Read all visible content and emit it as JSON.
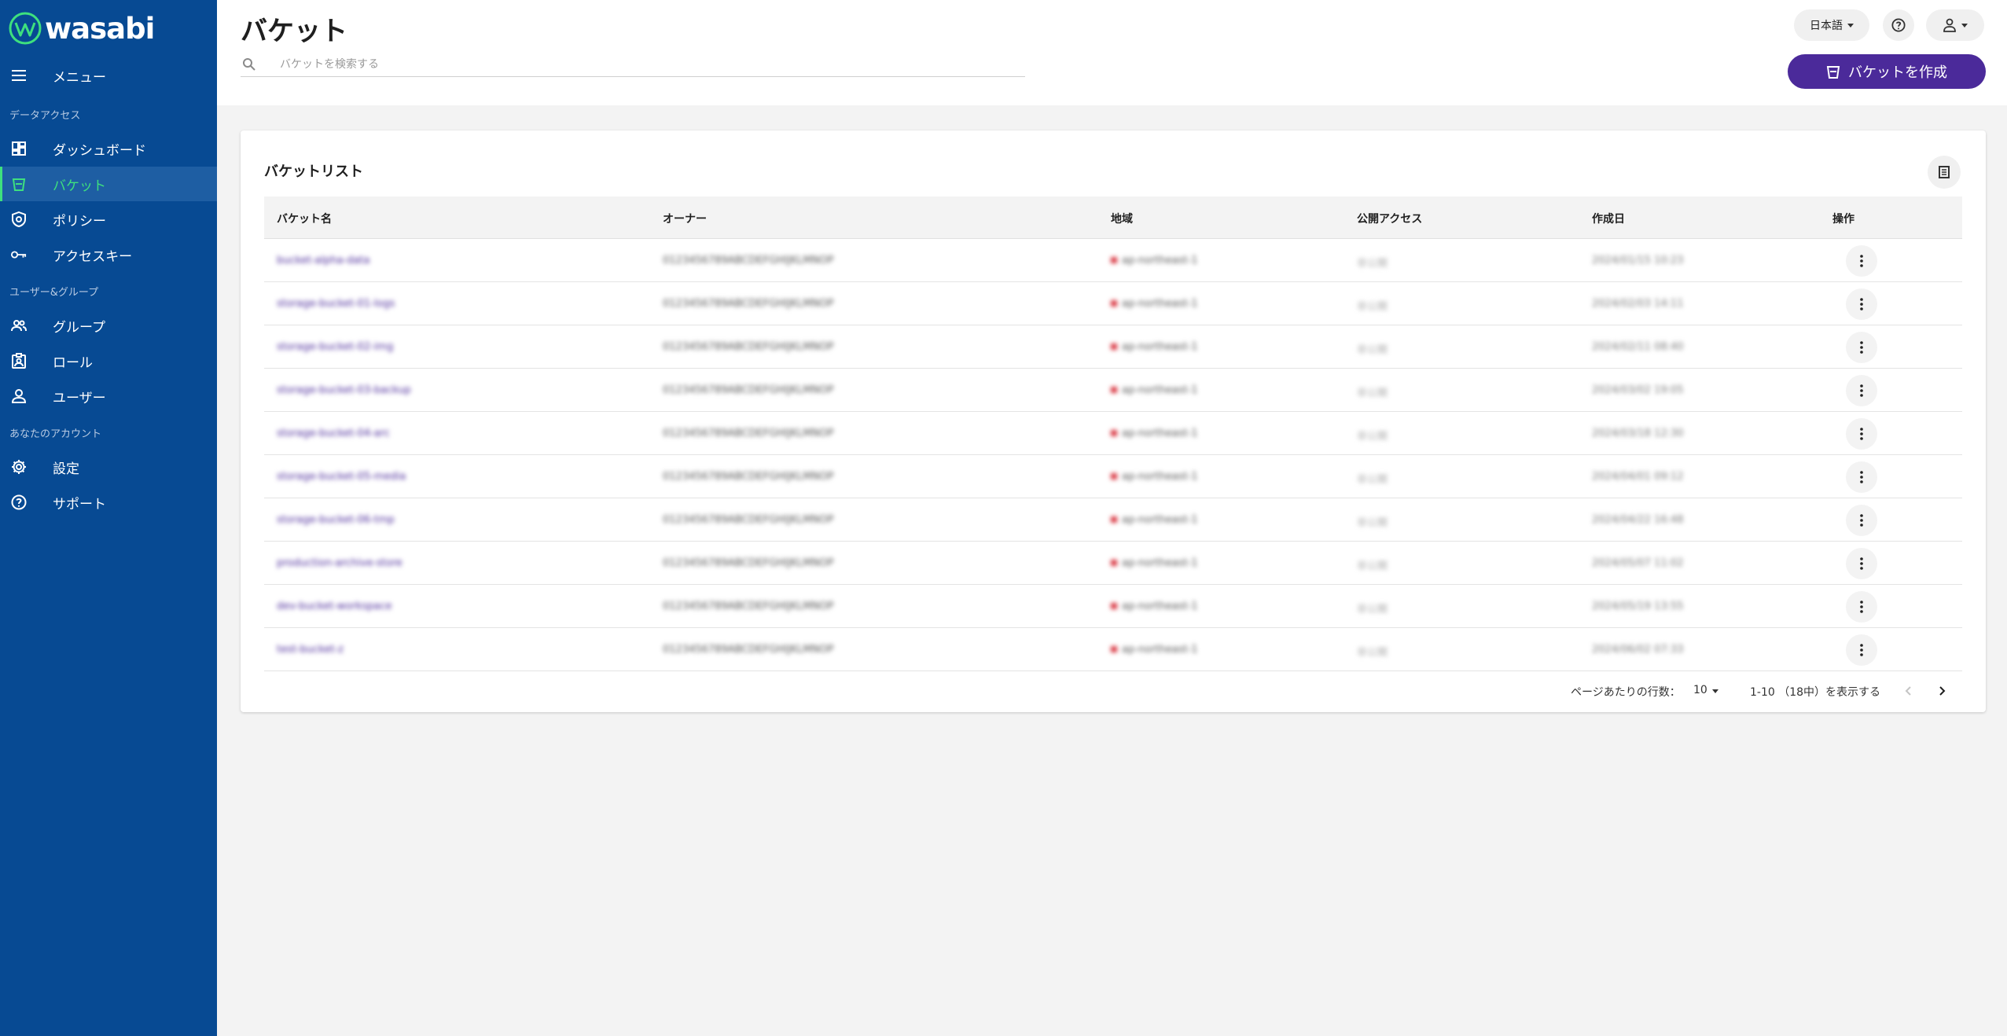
{
  "brand": {
    "name": "wasabi",
    "accent": "#3ee07e",
    "sidebar_bg": "#074a93",
    "primary": "#4b2a9a"
  },
  "sidebar": {
    "menu_label": "メニュー",
    "sections": {
      "data_access": "データアクセス",
      "users_groups": "ユーザー&グループ",
      "account": "あなたのアカウント"
    },
    "items": [
      {
        "label": "ダッシュボード",
        "icon": "dashboard-icon"
      },
      {
        "label": "バケット",
        "icon": "bucket-icon",
        "active": true
      },
      {
        "label": "ポリシー",
        "icon": "policy-shield-icon"
      },
      {
        "label": "アクセスキー",
        "icon": "key-icon"
      },
      {
        "label": "グループ",
        "icon": "group-icon"
      },
      {
        "label": "ロール",
        "icon": "role-badge-icon"
      },
      {
        "label": "ユーザー",
        "icon": "user-icon"
      },
      {
        "label": "設定",
        "icon": "gear-icon"
      },
      {
        "label": "サポート",
        "icon": "help-circle-icon"
      }
    ]
  },
  "header": {
    "title": "バケット",
    "search_placeholder": "バケットを検索する",
    "language": "日本語",
    "create_button": "バケットを作成"
  },
  "card": {
    "title": "バケットリスト",
    "columns": [
      "バケット名",
      "オーナー",
      "地域",
      "公開アクセス",
      "作成日",
      "操作"
    ],
    "rows": [
      {
        "name": "bucket-alpha-data",
        "owner": "0123456789ABCDEFGHIJKLMNOP",
        "region": "ap-northeast-1",
        "access": "非公開",
        "date": "2024/01/15 10:23"
      },
      {
        "name": "storage-bucket-01-logs",
        "owner": "0123456789ABCDEFGHIJKLMNOP",
        "region": "ap-northeast-1",
        "access": "非公開",
        "date": "2024/02/03 14:11"
      },
      {
        "name": "storage-bucket-02-img",
        "owner": "0123456789ABCDEFGHIJKLMNOP",
        "region": "ap-northeast-1",
        "access": "非公開",
        "date": "2024/02/11 08:40"
      },
      {
        "name": "storage-bucket-03-backup",
        "owner": "0123456789ABCDEFGHIJKLMNOP",
        "region": "ap-northeast-1",
        "access": "非公開",
        "date": "2024/03/02 19:05"
      },
      {
        "name": "storage-bucket-04-arc",
        "owner": "0123456789ABCDEFGHIJKLMNOP",
        "region": "ap-northeast-1",
        "access": "非公開",
        "date": "2024/03/18 12:30"
      },
      {
        "name": "storage-bucket-05-media",
        "owner": "0123456789ABCDEFGHIJKLMNOP",
        "region": "ap-northeast-1",
        "access": "非公開",
        "date": "2024/04/01 09:12"
      },
      {
        "name": "storage-bucket-06-tmp",
        "owner": "0123456789ABCDEFGHIJKLMNOP",
        "region": "ap-northeast-1",
        "access": "非公開",
        "date": "2024/04/22 16:48"
      },
      {
        "name": "production-archive-store",
        "owner": "0123456789ABCDEFGHIJKLMNOP",
        "region": "ap-northeast-1",
        "access": "非公開",
        "date": "2024/05/07 11:02"
      },
      {
        "name": "dev-bucket-workspace",
        "owner": "0123456789ABCDEFGHIJKLMNOP",
        "region": "ap-northeast-1",
        "access": "非公開",
        "date": "2024/05/19 13:55"
      },
      {
        "name": "test-bucket-z",
        "owner": "0123456789ABCDEFGHIJKLMNOP",
        "region": "ap-northeast-1",
        "access": "非公開",
        "date": "2024/06/02 07:33"
      }
    ],
    "pagination": {
      "rows_per_page_label": "ページあたりの行数：",
      "rows_per_page": "10",
      "range": "1-10 （18中）を表示する"
    }
  }
}
